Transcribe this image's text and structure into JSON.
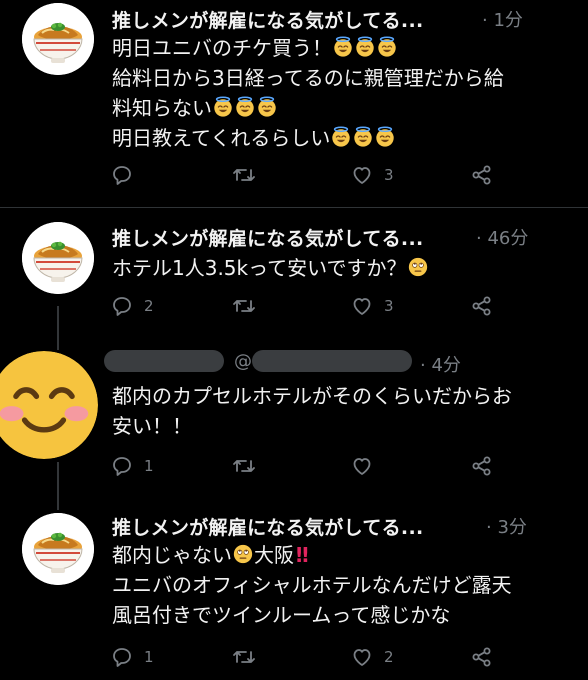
{
  "tweets": [
    {
      "name": "推しメンが解雇になる気がしてる...",
      "time": "· 1分",
      "lines": [
        "明日ユニバのチケ買う！",
        "給料日から3日経ってるのに親管理だから給",
        "料知らない",
        "明日教えてくれるらしい"
      ],
      "counts": {
        "reply": "",
        "retweet": "",
        "like": "3"
      }
    },
    {
      "name": "推しメンが解雇になる気がしてる...",
      "time": "· 46分",
      "lines": [
        "ホテル1人3.5kって安いですか？"
      ],
      "counts": {
        "reply": "2",
        "retweet": "",
        "like": "3"
      }
    },
    {
      "name": "",
      "handle_prefix": "@",
      "time": "· 4分",
      "lines": [
        "都内のカプセルホテルがそのくらいだからお",
        "安い！！"
      ],
      "counts": {
        "reply": "1",
        "retweet": "",
        "like": ""
      }
    },
    {
      "name": "推しメンが解雇になる気がしてる...",
      "time": "· 3分",
      "lines": [
        "都内じゃない",
        "大阪",
        "ユニバのオフィシャルホテルなんだけど露天",
        "風呂付きでツインルームって感じかな"
      ],
      "counts": {
        "reply": "1",
        "retweet": "",
        "like": "2"
      }
    }
  ],
  "icons": {
    "reply": "reply-icon",
    "retweet": "retweet-icon",
    "like": "heart-icon",
    "share": "share-icon"
  },
  "colors": {
    "background": "#000000",
    "muted": "#7a7f85",
    "text": "#f2f2f2",
    "accent_red": "#e0245e"
  }
}
